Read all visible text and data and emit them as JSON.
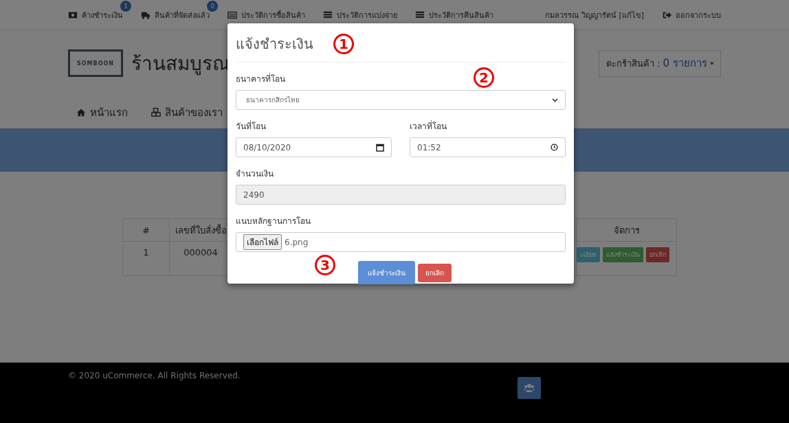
{
  "top_bar": {
    "items": [
      {
        "kind": "money",
        "label": "ค้างชำระเงิน",
        "badge": "1"
      },
      {
        "kind": "truck",
        "label": "สินค้าที่จัดส่งแล้ว",
        "badge": "0"
      },
      {
        "kind": "card",
        "label": "ประวัติการซื้อสินค้า"
      },
      {
        "kind": "list",
        "label": "ประวัติการแบ่งจ่าย"
      },
      {
        "kind": "list",
        "label": "ประวัติการคืนสินค้า"
      }
    ],
    "user": "กมลวรรณ วิญญารัตน์ [แก้ไข]",
    "logout": "ออกจากระบบ"
  },
  "header": {
    "logo_text": "SOMBOON",
    "shop_name": "ร้านสมบูรณ",
    "cart": {
      "label": "ตะกร้าสินค้า :",
      "count": "0 รายการ"
    }
  },
  "nav": [
    {
      "kind": "home",
      "label": "หน้าแรก"
    },
    {
      "kind": "cubes",
      "label": "สินค้าของเรา"
    }
  ],
  "orders_table": {
    "columns": [
      "#",
      "เลขที่ใบสั่งซื้อ",
      "จัดการ"
    ],
    "rows": [
      {
        "cells": [
          "1",
          "000004"
        ],
        "actions": [
          {
            "kind": "info",
            "label": "ะเอียด"
          },
          {
            "kind": "success",
            "label": "แจ้งชำระเงิน"
          },
          {
            "kind": "danger",
            "label": "ยกเลิก"
          }
        ]
      }
    ]
  },
  "footer": {
    "copyright": "© 2020 uCommerce. All Rights Reserved."
  },
  "modal": {
    "title": "แจ้งชำระเงิน",
    "bank": {
      "label": "ธนาคารที่โอน",
      "value": "ธนาคารกสิกรไทย"
    },
    "date": {
      "label": "วันที่โอน",
      "value": "08/10/2020"
    },
    "time": {
      "label": "เวลาที่โอน",
      "value": "01:52"
    },
    "amount": {
      "label": "จำนวนเงิน",
      "value": "2490",
      "disabled": true
    },
    "slip": {
      "label": "แนบหลักฐานการโอน",
      "button": "เลือกไฟล์",
      "file": "6.png"
    },
    "buttons": [
      {
        "kind": "primary",
        "label": "แจ้งชำระเงิน"
      },
      {
        "kind": "danger",
        "label": "ยกเลิก"
      }
    ]
  },
  "annotations": [
    "1",
    "2",
    "3"
  ]
}
